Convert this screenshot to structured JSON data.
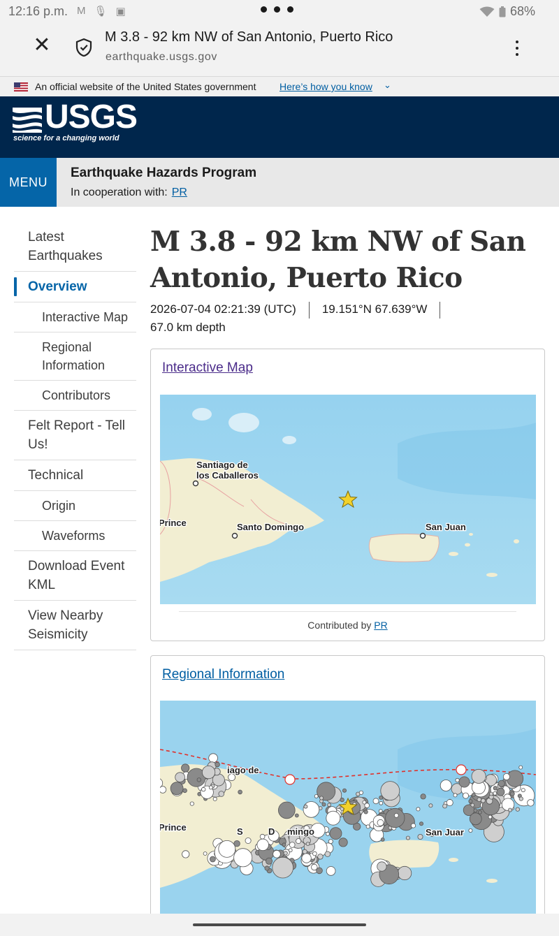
{
  "status_bar": {
    "time": "12:16 p.m.",
    "battery": "68%"
  },
  "browser": {
    "page_title": "M 3.8 - 92 km NW of San Antonio, Puerto Rico",
    "domain": "earthquake.usgs.gov",
    "close_icon": "close-icon",
    "security_icon": "shield-check-icon",
    "menu_icon": "more-vert-icon"
  },
  "gov_banner": {
    "text": "An official website of the United States government",
    "link": "Here’s how you know"
  },
  "usgs_header": {
    "wordmark": "USGS",
    "tagline": "science for a changing world"
  },
  "program_bar": {
    "menu_label": "MENU",
    "program_name": "Earthquake Hazards Program",
    "cooperation_label": "In cooperation with:",
    "cooperation_link": "PR"
  },
  "sidebar": {
    "items": [
      {
        "label": "Latest Earthquakes",
        "level": 0
      },
      {
        "label": "Overview",
        "level": 0,
        "active": true
      },
      {
        "label": "Interactive Map",
        "level": 1
      },
      {
        "label": "Regional Information",
        "level": 1
      },
      {
        "label": "Contributors",
        "level": 1
      },
      {
        "label": "Felt Report - Tell Us!",
        "level": 0
      },
      {
        "label": "Technical",
        "level": 0
      },
      {
        "label": "Origin",
        "level": 1
      },
      {
        "label": "Waveforms",
        "level": 1
      },
      {
        "label": "Download Event KML",
        "level": 0
      },
      {
        "label": "View Nearby Seismicity",
        "level": 0
      }
    ]
  },
  "event": {
    "title": "M 3.8 - 92 km NW of San Antonio, Puerto Rico",
    "time": "2026-07-04 02:21:39 (UTC)",
    "location": "19.151°N 67.639°W",
    "depth": "67.0 km depth"
  },
  "interactive_map_card": {
    "link": "Interactive Map",
    "contributed_by_label": "Contributed by",
    "contributed_by_link": "PR",
    "map_labels": {
      "santiago_line1": "Santiago de",
      "santiago_line2": "los Caballeros",
      "port_au_prince": "Prince",
      "santo_domingo": "Santo Domingo",
      "san_juan": "San Juan"
    }
  },
  "regional_card": {
    "link": "Regional Information",
    "map_labels": {
      "santiago_fragment": "iago de",
      "port_au_prince": "Prince",
      "santo_domingo_1": "S",
      "santo_domingo_2": "D",
      "santo_domingo_3": "mingo",
      "san_juan": "San Juar"
    }
  },
  "colors": {
    "usgs_navy": "#00264c",
    "menu_blue": "#0565a8",
    "link_blue": "#005ea2",
    "visited_link": "#4b2c8a",
    "ocean": "#9ad3ee",
    "land": "#f2eed2",
    "plate_boundary": "#e0302a"
  }
}
